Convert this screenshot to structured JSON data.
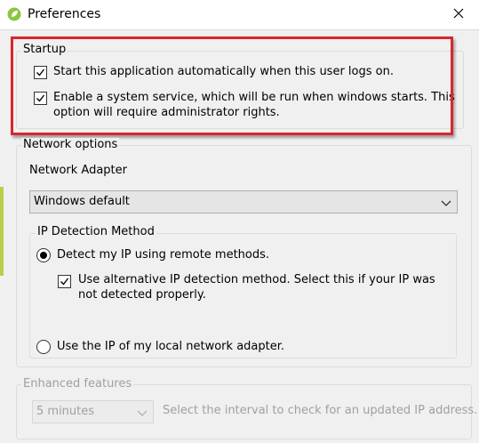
{
  "window": {
    "title": "Preferences",
    "app_icon": "app-leaf-icon",
    "close_icon": "close-icon"
  },
  "startup": {
    "legend": "Startup",
    "autostart": {
      "label": "Start this application automatically when this user logs on.",
      "checked": true
    },
    "service": {
      "label_line1": "Enable a system service, which will be run when windows starts. This",
      "label_line2": "option will require administrator rights.",
      "checked": true
    }
  },
  "network": {
    "legend": "Network options",
    "adapter_label": "Network Adapter",
    "adapter_value": "Windows default",
    "ip_detection": {
      "legend": "IP Detection Method",
      "remote": {
        "label": "Detect my IP using remote methods.",
        "selected": true
      },
      "alternative": {
        "label_line1": "Use alternative IP detection method. Select this if your IP was",
        "label_line2": "not detected properly.",
        "checked": true
      },
      "local": {
        "label": "Use the IP of my local network adapter.",
        "selected": false
      }
    }
  },
  "enhanced": {
    "legend": "Enhanced features",
    "interval_value": "5 minutes",
    "interval_hint": "Select the interval to check for an updated IP address.",
    "disabled": true
  },
  "colors": {
    "highlight_border": "#d9262c",
    "background": "#f0f0f0",
    "disabled_text": "#a0a0a0"
  }
}
